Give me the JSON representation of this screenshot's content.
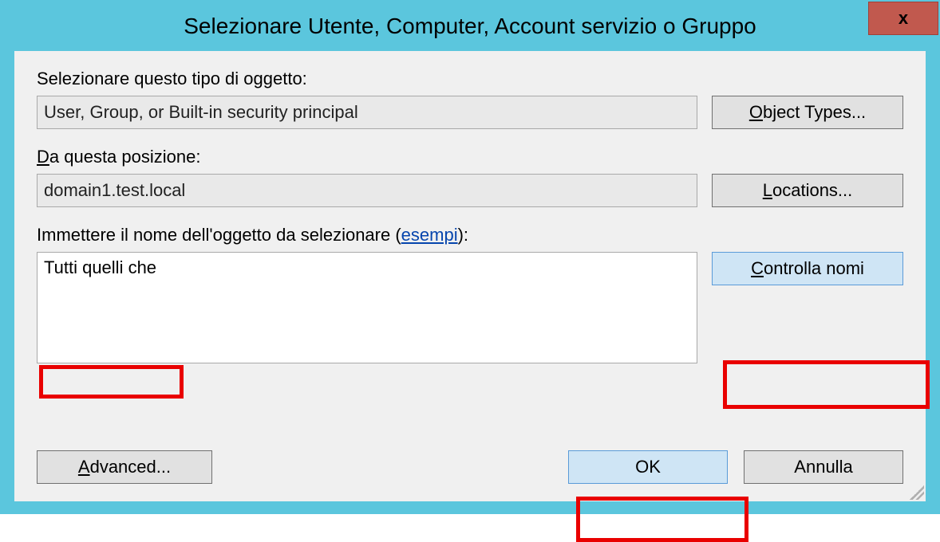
{
  "title": "Selezionare Utente, Computer, Account servizio o Gruppo",
  "labels": {
    "object_type": "Selezionare questo tipo di oggetto:",
    "from_location_pre": "D",
    "from_location_rest": "a questa posizione:",
    "enter_name_pre": "Immettere il nome dell'oggetto da selezionare (",
    "enter_name_link": "esempi",
    "enter_name_post": "):"
  },
  "fields": {
    "object_type": "User, Group, or Built-in security principal",
    "location": "domain1.test.local",
    "object_name": "Tutti quelli che"
  },
  "buttons": {
    "object_types_pre": "O",
    "object_types_rest": "bject Types...",
    "locations_pre": "L",
    "locations_rest": "ocations...",
    "check_names_pre": "C",
    "check_names_rest": "ontrolla nomi",
    "advanced_pre": "A",
    "advanced_rest": "dvanced...",
    "ok": "OK",
    "cancel": "Annulla"
  },
  "close": "x"
}
